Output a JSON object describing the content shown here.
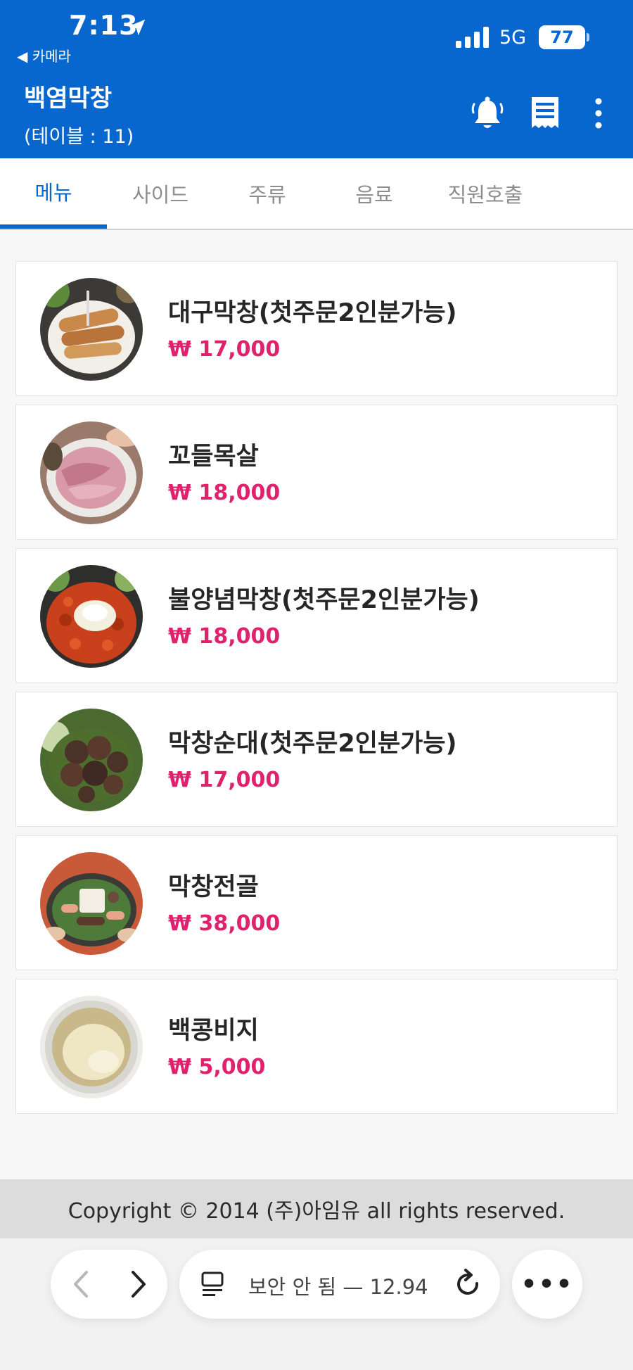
{
  "status_bar": {
    "time": "7:13",
    "back_app": "◀ 카메라",
    "network": "5G",
    "battery": "77"
  },
  "header": {
    "store_name": "백염막창",
    "table_label": "(테이블 : 11)"
  },
  "tabs": [
    {
      "label": "메뉴",
      "active": true
    },
    {
      "label": "사이드",
      "active": false
    },
    {
      "label": "주류",
      "active": false
    },
    {
      "label": "음료",
      "active": false
    },
    {
      "label": "직원호출",
      "active": false
    }
  ],
  "menu_items": [
    {
      "name": "대구막창(첫주문2인분가능)",
      "price": "₩ 17,000",
      "image": "grilled-makchang"
    },
    {
      "name": "꼬들목살",
      "price": "₩ 18,000",
      "image": "raw-pork-neck"
    },
    {
      "name": "불양념막창(첫주문2인분가능)",
      "price": "₩ 18,000",
      "image": "spicy-makchang"
    },
    {
      "name": "막창순대(첫주문2인분가능)",
      "price": "₩ 17,000",
      "image": "makchang-sundae"
    },
    {
      "name": "막창전골",
      "price": "₩ 38,000",
      "image": "makchang-stew"
    },
    {
      "name": "백콩비지",
      "price": "₩ 5,000",
      "image": "soybean-pulp"
    }
  ],
  "footer": {
    "copyright": "Copyright © 2014 (주)아임유 all rights reserved."
  },
  "browser": {
    "url_text": "보안 안 됨 — 12.94",
    "more_label": "•••"
  },
  "colors": {
    "primary": "#0767cf",
    "price": "#e0226e"
  }
}
